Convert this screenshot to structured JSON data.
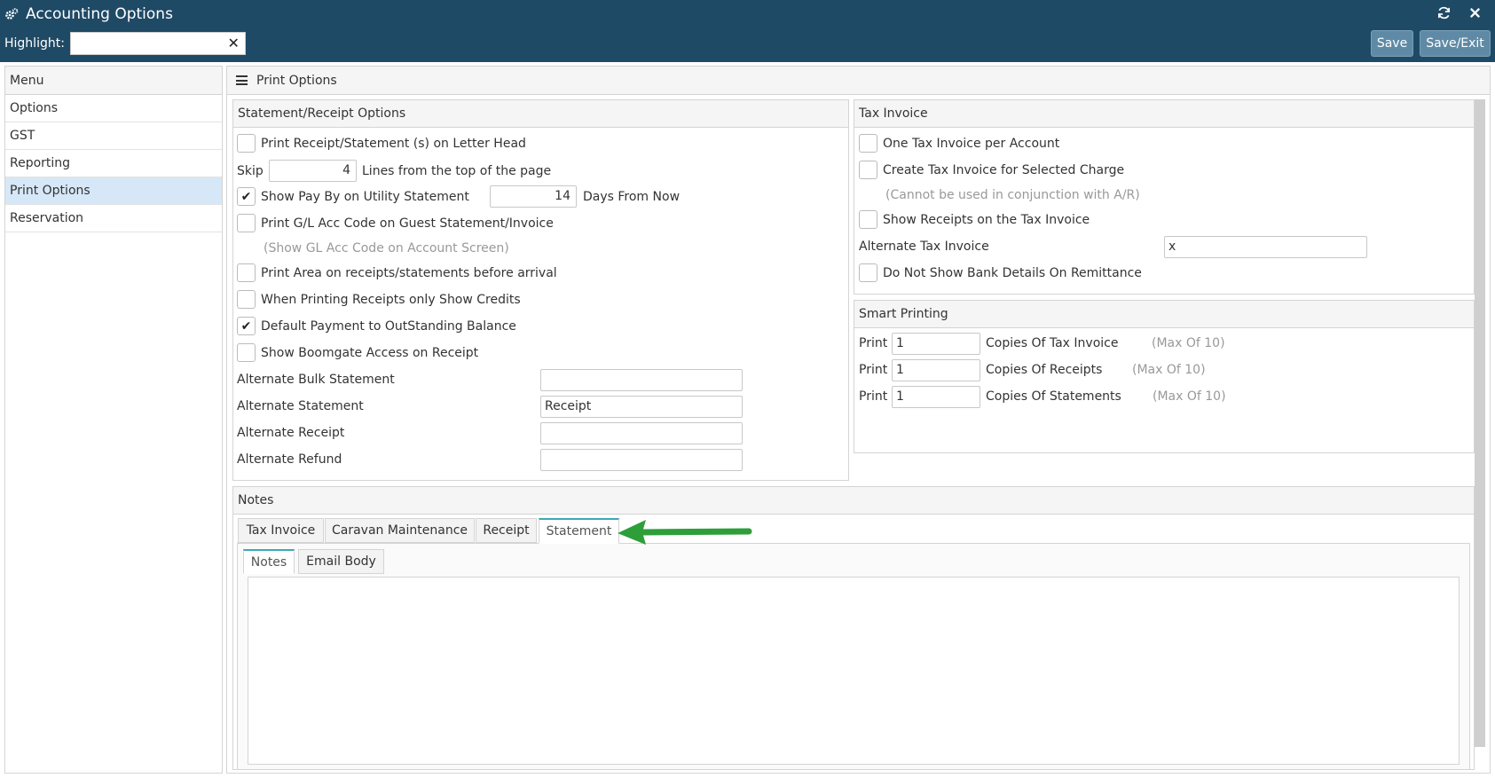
{
  "window": {
    "title": "Accounting Options",
    "highlight_label": "Highlight:",
    "highlight_value": "",
    "save_label": "Save",
    "save_exit_label": "Save/Exit"
  },
  "menu": {
    "header": "Menu",
    "items": [
      "Options",
      "GST",
      "Reporting",
      "Print Options",
      "Reservation"
    ],
    "active_index": 3
  },
  "main": {
    "title": "Print Options"
  },
  "statement_receipt": {
    "title": "Statement/Receipt Options",
    "print_letterhead": {
      "label": "Print Receipt/Statement (s) on Letter Head",
      "checked": false
    },
    "skip_label": "Skip",
    "skip_value": "4",
    "skip_suffix": "Lines from the top of the page",
    "show_pay_by": {
      "label": "Show Pay By on Utility Statement",
      "checked": true
    },
    "days_value": "14",
    "days_suffix": "Days From Now",
    "print_gl": {
      "label": "Print G/L Acc Code on Guest Statement/Invoice",
      "checked": false
    },
    "gl_note": "(Show GL Acc Code on Account Screen)",
    "print_area": {
      "label": "Print Area on receipts/statements before arrival",
      "checked": false
    },
    "only_credits": {
      "label": "When Printing Receipts only Show Credits",
      "checked": false
    },
    "default_payment": {
      "label": "Default Payment to OutStanding Balance",
      "checked": true
    },
    "boomgate": {
      "label": "Show Boomgate Access on Receipt",
      "checked": false
    },
    "alt_bulk_label": "Alternate Bulk Statement",
    "alt_bulk_value": "",
    "alt_statement_label": "Alternate Statement",
    "alt_statement_value": "Receipt",
    "alt_receipt_label": "Alternate Receipt",
    "alt_receipt_value": "",
    "alt_refund_label": "Alternate Refund",
    "alt_refund_value": ""
  },
  "tax_invoice": {
    "title": "Tax Invoice",
    "one_per_account": {
      "label": "One Tax Invoice per Account",
      "checked": false
    },
    "create_selected": {
      "label": "Create Tax Invoice for Selected Charge",
      "checked": false
    },
    "ar_note": "(Cannot be used in conjunction with A/R)",
    "show_receipts": {
      "label": "Show Receipts on the Tax Invoice",
      "checked": false
    },
    "alt_label": "Alternate Tax Invoice",
    "alt_value": "x",
    "no_bank": {
      "label": "Do Not Show Bank Details On Remittance",
      "checked": false
    }
  },
  "smart_printing": {
    "title": "Smart Printing",
    "print_label": "Print",
    "rows": [
      {
        "value": "1",
        "label": "Copies Of Tax Invoice",
        "max": "(Max Of 10)"
      },
      {
        "value": "1",
        "label": "Copies Of Receipts",
        "max": "(Max Of 10)"
      },
      {
        "value": "1",
        "label": "Copies Of Statements",
        "max": "(Max Of 10)"
      }
    ]
  },
  "notes": {
    "title": "Notes",
    "tabs": [
      "Tax Invoice",
      "Caravan Maintenance",
      "Receipt",
      "Statement"
    ],
    "active_tab": 3,
    "subtabs": [
      "Notes",
      "Email Body"
    ],
    "active_subtab": 0,
    "content": ""
  },
  "colors": {
    "header_bg": "#1f4a66",
    "active_menu": "#d6e8f7",
    "active_tab_accent": "#3fa7b6",
    "annotation_arrow": "#2e9e3a"
  }
}
